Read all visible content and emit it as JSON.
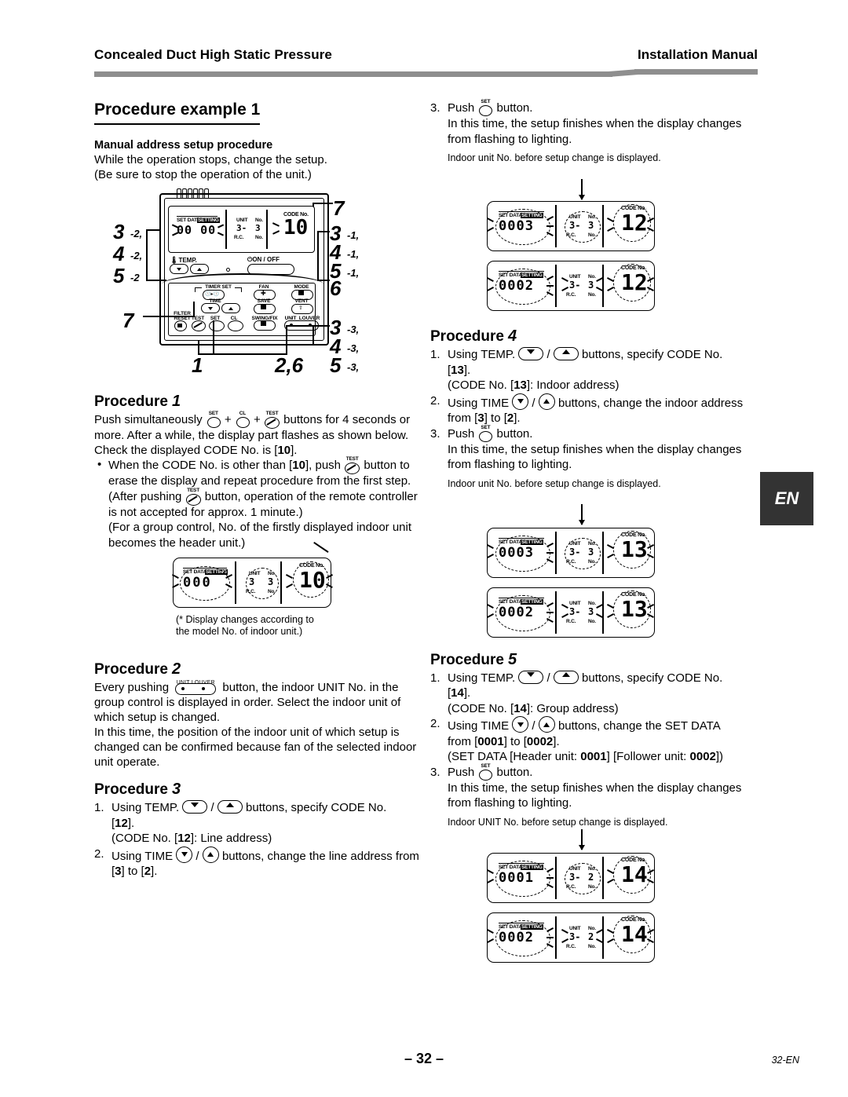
{
  "header": {
    "left_title": "Concealed Duct High Static Pressure",
    "right_title": "Installation Manual"
  },
  "side_tab": {
    "label": "EN"
  },
  "footer": {
    "page_number": "– 32 –",
    "code": "32-EN"
  },
  "left_column": {
    "page_title": "Procedure example 1",
    "intro": {
      "heading": "Manual address setup procedure",
      "line1": "While the operation stops, change the setup.",
      "line2": "(Be sure to stop the operation of the unit.)"
    },
    "controller_figure": {
      "lcd": {
        "set_data_label": "SET DATA",
        "setting_label": "SETTING",
        "value": "00 00",
        "unit_label": "UNIT",
        "unit_no_label": "No.",
        "rc_label": "R.C.",
        "rc_no_label": "No.",
        "unit_value": "3-",
        "rc_value": "3",
        "code_no_label": "CODE No.",
        "code_value": "10"
      },
      "temp_label": "TEMP.",
      "onoff_label": "ON / OFF",
      "timer_set_label": "TIMER SET",
      "time_label": "TIME",
      "fan_label": "FAN",
      "mode_label": "MODE",
      "save_label": "SAVE",
      "vent_label": "VENT",
      "filter_label": "FILTER",
      "reset_label": "RESET",
      "test_label": "TEST",
      "set_label": "SET",
      "cl_label": "CL",
      "swingfix_label": "SWING/FIX",
      "unit_label": "UNIT",
      "louver_label": "LOUVER",
      "callouts": {
        "left_group": [
          "3",
          "-2,",
          "4",
          "-2,",
          "5",
          "-2"
        ],
        "left_seven": "7",
        "top_seven": "7",
        "right_group_1": [
          "3",
          "-1,",
          "4",
          "-1,",
          "5",
          "-1,",
          "6"
        ],
        "right_group_3": [
          "3",
          "-3,",
          "4",
          "-3,",
          "5",
          "-3,"
        ],
        "bottom_one": "1",
        "bottom_two_six": "2,6"
      }
    },
    "procedure_1": {
      "title": "Procedure",
      "number": "1",
      "body_a": "Push simultaneously",
      "body_b": "buttons for 4 seconds or more. After a while, the display part flashes as shown below. Check the displayed CODE No. is [",
      "code_10": "10",
      "body_c": "].",
      "bullet_a": "When the CODE No. is other than [",
      "bullet_b": "], push",
      "bullet_c": "button to erase the display and repeat procedure from the first step.",
      "bullet_d": "(After pushing",
      "bullet_e": "button, operation of the remote controller is not accepted for approx. 1 minute.)",
      "bullet_f": "(For a group control, No. of the firstly displayed indoor unit becomes the header unit.)",
      "figure": {
        "set_data_label": "SET DATA",
        "setting_label": "SETTING",
        "value": "000",
        "unit_label": "UNIT",
        "unit_no_label": "No.",
        "rc_label": "R.C.",
        "rc_no_label": "No.",
        "unit_value": "3",
        "rc_value": "3",
        "code_no_label": "CODE No.",
        "code_value": "10"
      },
      "caption_line1": "(* Display changes according to",
      "caption_line2": "the model No. of indoor unit.)"
    },
    "procedure_2": {
      "title": "Procedure",
      "number": "2",
      "unit_cap": "UNIT",
      "louver_cap": "LOUVER",
      "body_a": "Every pushing",
      "body_b": "button, the indoor UNIT No. in the group control is displayed in order. Select the indoor unit of which setup is changed.",
      "body_c": "In this time, the position of the indoor unit of which setup is changed can be confirmed because fan of the selected indoor unit operate."
    },
    "procedure_3": {
      "title": "Procedure",
      "number": "3",
      "step1_marker": "1.",
      "step1_a": "Using TEMP.",
      "step1_slash": "/",
      "step1_b": "buttons, specify CODE No.",
      "step1_code": "12",
      "step1_c": "[",
      "step1_d": "].",
      "step1_note": "(CODE No. [",
      "step1_note_code": "12",
      "step1_note_end": "]: Line address)",
      "step2_marker": "2.",
      "step2_a": "Using TIME",
      "step2_b": "buttons, change the line address from [",
      "step2_from": "3",
      "step2_mid": "] to [",
      "step2_to": "2",
      "step2_end": "]."
    }
  },
  "right_column": {
    "top_step": {
      "marker": "3.",
      "push_text": "Push",
      "button_text": "button.",
      "detail": "In this time, the setup finishes when the display changes from flashing to lighting.",
      "note": "Indoor unit No. before setup change is displayed."
    },
    "figure_12": {
      "top": {
        "set_data_label": "SET DATA",
        "setting_label": "SETTING",
        "value": "0003",
        "unit_label": "UNIT",
        "unit_no_label": "No.",
        "rc_label": "R.C.",
        "rc_no_label": "No.",
        "unit_value": "3-",
        "rc_value": "3",
        "code_no_label": "CODE No.",
        "code_value": "12"
      },
      "bottom": {
        "set_data_label": "SET DATA",
        "setting_label": "SETTING",
        "value": "0002",
        "unit_label": "UNIT",
        "unit_no_label": "No.",
        "rc_label": "R.C.",
        "rc_no_label": "No.",
        "unit_value": "3-",
        "rc_value": "3",
        "code_no_label": "CODE No.",
        "code_value": "12"
      }
    },
    "procedure_4": {
      "title": "Procedure",
      "number": "4",
      "step1_marker": "1.",
      "step1_a": "Using TEMP.",
      "step1_slash": "/",
      "step1_b": "buttons, specify CODE No.",
      "step1_c": "[",
      "step1_code": "13",
      "step1_d": "].",
      "step1_note": "(CODE No. [",
      "step1_note_code": "13",
      "step1_note_end": "]: Indoor address)",
      "step2_marker": "2.",
      "step2_a": "Using TIME",
      "step2_b": "buttons, change the indoor address from [",
      "step2_from": "3",
      "step2_mid": "] to [",
      "step2_to": "2",
      "step2_end": "].",
      "step3_marker": "3.",
      "step3_push": "Push",
      "step3_button": "button.",
      "step3_detail": "In this time, the setup finishes when the display changes from flashing to lighting.",
      "note": "Indoor unit No. before setup change is displayed."
    },
    "figure_13": {
      "top": {
        "set_data_label": "SET DATA",
        "setting_label": "SETTING",
        "value": "0003",
        "unit_label": "UNIT",
        "unit_no_label": "No.",
        "rc_label": "R.C.",
        "rc_no_label": "No.",
        "unit_value": "3-",
        "rc_value": "3",
        "code_no_label": "CODE No.",
        "code_value": "13"
      },
      "bottom": {
        "set_data_label": "SET DATA",
        "setting_label": "SETTING",
        "value": "0002",
        "unit_label": "UNIT",
        "unit_no_label": "No.",
        "rc_label": "R.C.",
        "rc_no_label": "No.",
        "unit_value": "3-",
        "rc_value": "3",
        "code_no_label": "CODE No.",
        "code_value": "13"
      }
    },
    "procedure_5": {
      "title": "Procedure",
      "number": "5",
      "step1_marker": "1.",
      "step1_a": "Using TEMP.",
      "step1_slash": "/",
      "step1_b": "buttons, specify CODE No.",
      "step1_c": "[",
      "step1_code": "14",
      "step1_d": "].",
      "step1_note": "(CODE No. [",
      "step1_note_code": "14",
      "step1_note_end": "]: Group address)",
      "step2_marker": "2.",
      "step2_a": "Using TIME",
      "step2_b": "buttons, change the SET DATA",
      "step2_from_text": "from [",
      "step2_from": "0001",
      "step2_mid": "] to [",
      "step2_to": "0002",
      "step2_end": "].",
      "step2_note_a": "(SET DATA [Header unit:",
      "step2_note_header": "0001",
      "step2_note_b": "] [Follower unit:",
      "step2_note_follower": "0002",
      "step2_note_c": "])",
      "step3_marker": "3.",
      "step3_push": "Push",
      "step3_button": "button.",
      "step3_detail": "In this time, the setup finishes when the display changes from flashing to lighting.",
      "note": "Indoor UNIT No. before setup change is displayed."
    },
    "figure_14": {
      "top": {
        "set_data_label": "SET DATA",
        "setting_label": "SETTING",
        "value": "0001",
        "unit_label": "UNIT",
        "unit_no_label": "No.",
        "rc_label": "R.C.",
        "rc_no_label": "No.",
        "unit_value": "3-",
        "rc_value": "2",
        "code_no_label": "CODE No.",
        "code_value": "14"
      },
      "bottom": {
        "set_data_label": "SET DATA",
        "setting_label": "SETTING",
        "value": "0002",
        "unit_label": "UNIT",
        "unit_no_label": "No.",
        "rc_label": "R.C.",
        "rc_no_label": "No.",
        "unit_value": "3-",
        "rc_value": "2",
        "code_no_label": "CODE No.",
        "code_value": "14"
      }
    }
  }
}
